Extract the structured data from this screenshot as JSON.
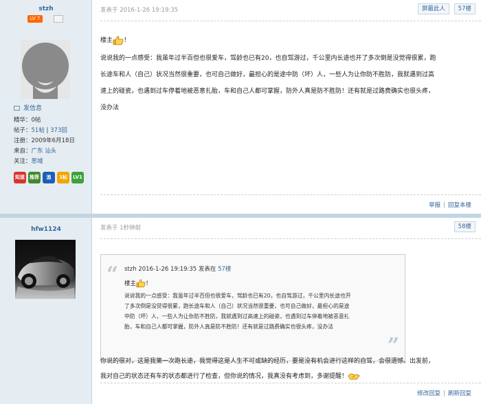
{
  "post1": {
    "author": "stzh",
    "level": "LV 7",
    "send_msg": "发信息",
    "stats": {
      "essence_label": "精华：",
      "essence_value": "0帖",
      "posts_label": "帖子：",
      "posts_value_a": "51帖",
      "posts_sep": " | ",
      "posts_value_b": "373回",
      "reg_label": "注册：",
      "reg_value": "2009年6月18日",
      "from_label": "来自：",
      "from_value_a": "广东",
      "from_value_b": "汕头",
      "follow_label": "关注：",
      "follow_value": "思域"
    },
    "badges": [
      "知道",
      "推荐",
      "追",
      "1帖",
      "LV1"
    ],
    "badge_colors": [
      "#d9342b",
      "#3f8a2e",
      "#1d5fb7",
      "#f2a500",
      "#3da23a"
    ],
    "meta": "发表于 2016-1-26 19:19:35",
    "block_btn": "屏蔽此人",
    "floor": "57楼",
    "greeting": "楼主",
    "greeting_end": "！",
    "lines": [
      "说说我的一点感受：我虽年过半百但也很爱车，驾龄也已有20，也自驾游过，千公里内长途也开了多次倒是没觉得很累，跑",
      "长途车和人（自己）状况当然很重要，也可自己做好，最担心的是途中防（坏）人，一些人为让你防不胜防，我就遇到过高",
      "速上的碰瓷，也遇到过车停着地被恶意扎胎，车和自己人都可掌握，防外人真是防不胜防！还有就是过路费确实也很头疼，",
      "没办法"
    ],
    "report": "举报",
    "reply": "回复本楼"
  },
  "post2": {
    "author": "hfw1124",
    "meta": "发表于 1秒钟前",
    "floor": "58楼",
    "quote": {
      "author": "stzh",
      "time": " 2016-1-26 19:19:35 发表在 ",
      "floor": "57楼",
      "greeting": "楼主",
      "greeting_end": "！",
      "lines": [
        "说说我的一点感受：我虽年过半百但也很爱车，驾龄也已有20，也自驾游过，千公里内长途也开",
        "了多次倒是没觉得很累，跑长途车和人（自己）状况当然很重要，也可自己做好，最担心的是途",
        "中防（坏）人，一些人为让你防不胜防，我就遇到过高速上的碰瓷，也遇到过车停着地被恶意扎",
        "胎，车和自己人都可掌握，防外人真是防不胜防！还有就是过路费确实也很头疼，没办法"
      ]
    },
    "lines": [
      "你说的很对，这是我第一次跑长途，我觉得这是人生不可或缺的经历，要是没有机会进行这样的自驾，会很遗憾。出发前，",
      "我对自己的状态还有车的状态都进行了检查，但你说的情况，我真没有考虑到，多谢提醒！"
    ],
    "edit": "修改回复",
    "refresh": "刷新回复"
  }
}
